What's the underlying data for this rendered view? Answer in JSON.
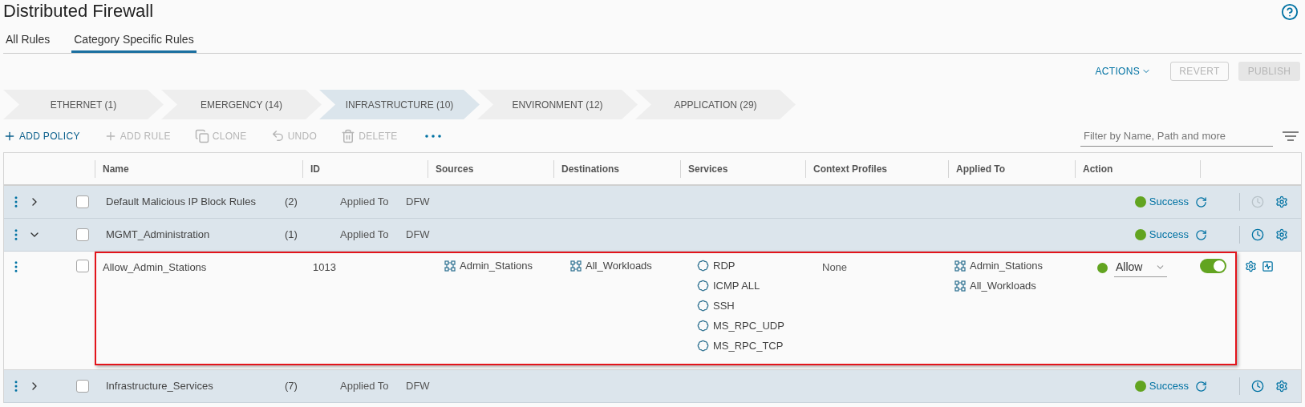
{
  "page": {
    "title": "Distributed Firewall"
  },
  "tabs": [
    {
      "label": "All Rules",
      "selected": false
    },
    {
      "label": "Category Specific Rules",
      "selected": true
    }
  ],
  "header_actions": {
    "actions": "ACTIONS",
    "revert": {
      "label": "REVERT",
      "disabled": true
    },
    "publish": {
      "label": "PUBLISH",
      "disabled": true
    }
  },
  "categories": [
    {
      "label": "ETHERNET (1)",
      "selected": false
    },
    {
      "label": "EMERGENCY (14)",
      "selected": false
    },
    {
      "label": "INFRASTRUCTURE (10)",
      "selected": true
    },
    {
      "label": "ENVIRONMENT (12)",
      "selected": false
    },
    {
      "label": "APPLICATION (29)",
      "selected": false
    }
  ],
  "toolbar": [
    {
      "kind": "add",
      "label": "ADD POLICY",
      "disabled": false
    },
    {
      "kind": "add",
      "label": "ADD RULE",
      "disabled": true
    },
    {
      "kind": "clone",
      "label": "CLONE",
      "disabled": true
    },
    {
      "kind": "undo",
      "label": "UNDO",
      "disabled": true
    },
    {
      "kind": "delete",
      "label": "DELETE",
      "disabled": true
    },
    {
      "kind": "more"
    }
  ],
  "filter": {
    "placeholder": "Filter by Name, Path and more"
  },
  "table": {
    "columns": [
      "Name",
      "ID",
      "Sources",
      "Destinations",
      "Services",
      "Context Profiles",
      "Applied To",
      "Action"
    ],
    "rows": [
      {
        "kind": "policy",
        "name": "Default Malicious IP Block Rules",
        "count": "(2)",
        "applied_label": "Applied To",
        "applied_to": "DFW",
        "status": "Success",
        "expanded": false,
        "checked": false,
        "history_enabled": false
      },
      {
        "kind": "policy",
        "name": "MGMT_Administration",
        "count": "(1)",
        "applied_label": "Applied To",
        "applied_to": "DFW",
        "status": "Success",
        "expanded": true,
        "checked": false,
        "history_enabled": true
      },
      {
        "kind": "rule",
        "name": "Allow_Admin_Stations",
        "id": "1013",
        "sources": [
          "Admin_Stations"
        ],
        "destinations": [
          "All_Workloads"
        ],
        "services": [
          "RDP",
          "ICMP ALL",
          "SSH",
          "MS_RPC_UDP",
          "MS_RPC_TCP"
        ],
        "context_profiles": "None",
        "applied_to": [
          "Admin_Stations",
          "All_Workloads"
        ],
        "action": "Allow",
        "enabled": true,
        "checked": false,
        "highlighted": true
      },
      {
        "kind": "policy",
        "name": "Infrastructure_Services",
        "count": "(7)",
        "applied_label": "Applied To",
        "applied_to": "DFW",
        "status": "Success",
        "expanded": false,
        "checked": false,
        "history_enabled": true
      }
    ]
  }
}
